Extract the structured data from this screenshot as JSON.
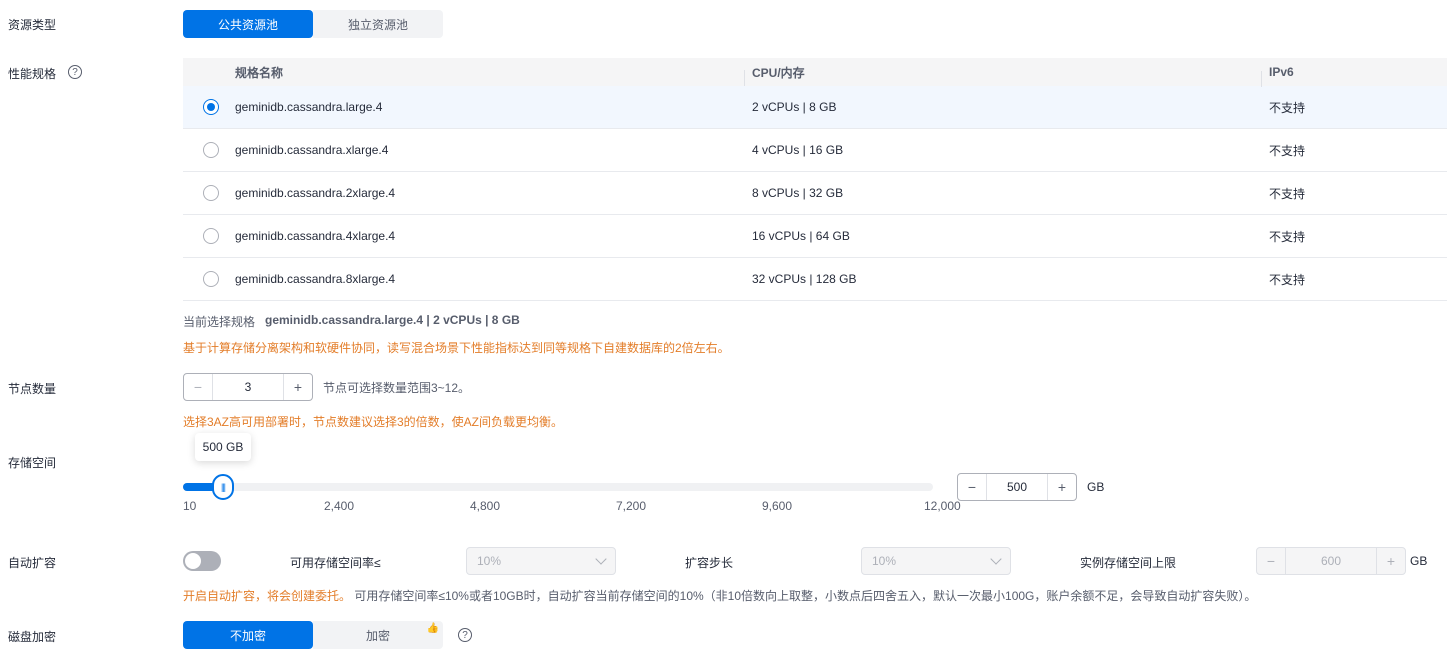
{
  "resource_type": {
    "label": "资源类型",
    "options": [
      "公共资源池",
      "独立资源池"
    ]
  },
  "spec": {
    "label": "性能规格",
    "columns": [
      "规格名称",
      "CPU/内存",
      "IPv6"
    ],
    "rows": [
      {
        "name": "geminidb.cassandra.large.4",
        "cpu_mem": "2 vCPUs | 8 GB",
        "ipv6": "不支持"
      },
      {
        "name": "geminidb.cassandra.xlarge.4",
        "cpu_mem": "4 vCPUs | 16 GB",
        "ipv6": "不支持"
      },
      {
        "name": "geminidb.cassandra.2xlarge.4",
        "cpu_mem": "8 vCPUs | 32 GB",
        "ipv6": "不支持"
      },
      {
        "name": "geminidb.cassandra.4xlarge.4",
        "cpu_mem": "16 vCPUs | 64 GB",
        "ipv6": "不支持"
      },
      {
        "name": "geminidb.cassandra.8xlarge.4",
        "cpu_mem": "32 vCPUs | 128 GB",
        "ipv6": "不支持"
      }
    ],
    "current_label": "当前选择规格",
    "current_value": "geminidb.cassandra.large.4 | 2 vCPUs | 8 GB",
    "note": "基于计算存储分离架构和软硬件协同，读写混合场景下性能指标达到同等规格下自建数据库的2倍左右。"
  },
  "nodes": {
    "label": "节点数量",
    "value": "3",
    "hint": "节点可选择数量范围3~12。",
    "warning": "选择3AZ高可用部署时，节点数建议选择3的倍数，使AZ间负载更均衡。"
  },
  "storage": {
    "label": "存储空间",
    "tooltip": "500 GB",
    "ticks": [
      "10",
      "2,400",
      "4,800",
      "7,200",
      "9,600",
      "12,000"
    ],
    "value": "500",
    "unit": "GB"
  },
  "autoscale": {
    "label": "自动扩容",
    "rate_label": "可用存储空间率≤",
    "rate_value": "10%",
    "step_label": "扩容步长",
    "step_value": "10%",
    "limit_label": "实例存储空间上限",
    "limit_value": "600",
    "limit_unit": "GB",
    "note_warn": "开启自动扩容，将会创建委托。",
    "note_rest": "可用存储空间率≤10%或者10GB时，自动扩容当前存储空间的10%（非10倍数向上取整，小数点后四舍五入，默认一次最小100G，账户余额不足，会导致自动扩容失败）。"
  },
  "encryption": {
    "label": "磁盘加密",
    "options": [
      "不加密",
      "加密"
    ]
  },
  "icons": {
    "help": "?",
    "minus": "−",
    "plus": "+",
    "thumb": "|||",
    "like": "👍"
  }
}
